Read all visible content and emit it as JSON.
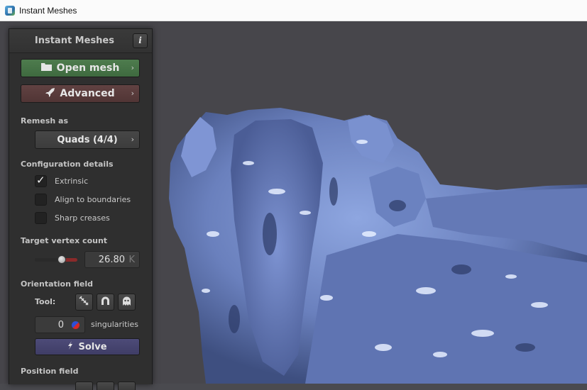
{
  "window": {
    "title": "Instant Meshes"
  },
  "panel": {
    "title": "Instant Meshes",
    "info_label": "i",
    "open_mesh_label": "Open mesh",
    "advanced_label": "Advanced",
    "remesh_as_label": "Remesh as",
    "remesh_mode": "Quads (4/4)",
    "config_label": "Configuration details",
    "options": [
      {
        "label": "Extrinsic",
        "checked": true
      },
      {
        "label": "Align to boundaries",
        "checked": false
      },
      {
        "label": "Sharp creases",
        "checked": false
      }
    ],
    "target_label": "Target vertex count",
    "target_value": "26.80",
    "target_unit": "K",
    "target_slider_level": 0.55,
    "orientation_label": "Orientation field",
    "tool_label": "Tool:",
    "tools": [
      "comb-icon",
      "magnet-icon",
      "ghost-icon"
    ],
    "singularities_value": "0",
    "singularities_label": "singularities",
    "solve_label": "Solve",
    "position_label": "Position field"
  },
  "colors": {
    "open_button": "#4e7c4e",
    "advanced_button": "#614242",
    "solve_button": "#4d4b78",
    "mesh": "#6f86c2",
    "background": "#47464b"
  }
}
